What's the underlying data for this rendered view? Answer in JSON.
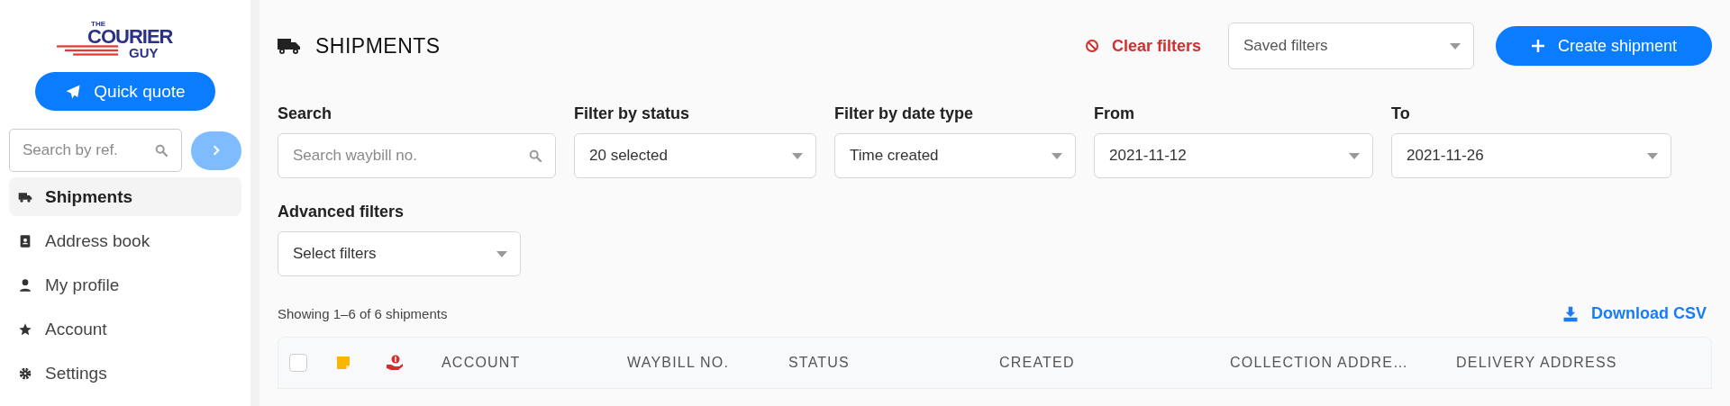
{
  "logo": {
    "top": "THE",
    "main": "COURIER",
    "bottom": "GUY"
  },
  "sidebar": {
    "quick_quote": "Quick quote",
    "search": {
      "placeholder": "Search by ref."
    },
    "items": [
      {
        "label": "Shipments",
        "kind": "truck",
        "selected": true
      },
      {
        "label": "Address book",
        "kind": "contact",
        "selected": false
      },
      {
        "label": "My profile",
        "kind": "person",
        "selected": false
      },
      {
        "label": "Account",
        "kind": "star",
        "selected": false
      },
      {
        "label": "Settings",
        "kind": "gear",
        "selected": false
      }
    ]
  },
  "header": {
    "title": "SHIPMENTS",
    "clear_filters": "Clear filters",
    "saved_filters": {
      "placeholder": "Saved filters"
    },
    "create": "Create shipment"
  },
  "filters": [
    {
      "label": "Search",
      "kind": "search",
      "placeholder": "Search waybill no."
    },
    {
      "label": "Filter by status",
      "kind": "select",
      "value": "20 selected"
    },
    {
      "label": "Filter by date type",
      "kind": "select",
      "value": "Time created"
    },
    {
      "label": "From",
      "kind": "select",
      "value": "2021-11-12"
    },
    {
      "label": "To",
      "kind": "select",
      "value": "2021-11-26"
    }
  ],
  "advanced_filters": {
    "label": "Advanced filters",
    "placeholder": "Select filters"
  },
  "summary": "Showing 1–6 of 6 shipments",
  "download": "Download CSV",
  "table": {
    "select_all": {
      "checked": false
    },
    "columns": [
      "ACCOUNT",
      "WAYBILL NO.",
      "STATUS",
      "CREATED",
      "COLLECTION ADDRE…",
      "DELIVERY ADDRESS"
    ]
  }
}
